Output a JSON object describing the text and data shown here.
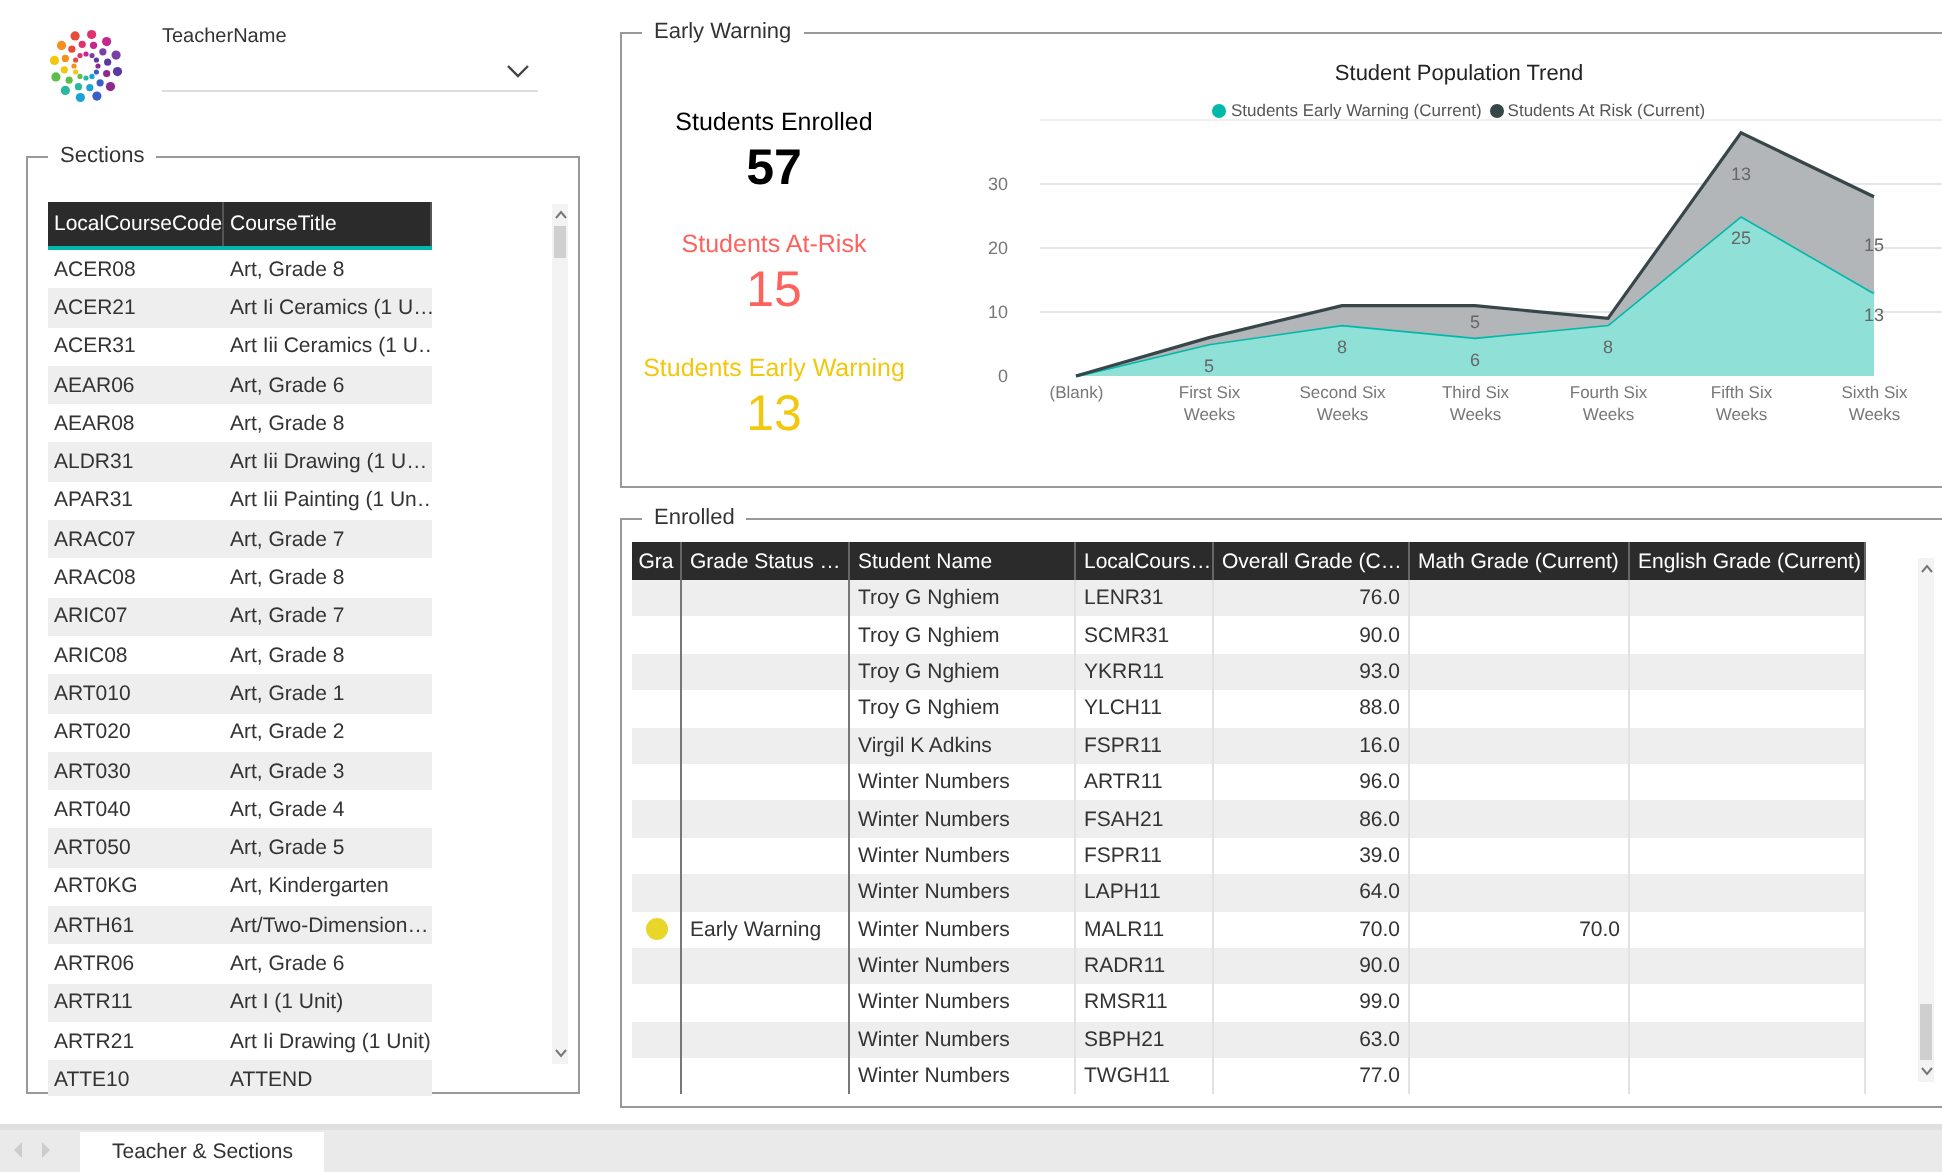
{
  "teacher_filter": {
    "label": "TeacherName"
  },
  "sections": {
    "title": "Sections",
    "columns": [
      "LocalCourseCode",
      "CourseTitle"
    ],
    "rows": [
      [
        "ACER08",
        "Art, Grade 8"
      ],
      [
        "ACER21",
        "Art Ii Ceramics (1 U…"
      ],
      [
        "ACER31",
        "Art Iii Ceramics (1 U…"
      ],
      [
        "AEAR06",
        "Art, Grade 6"
      ],
      [
        "AEAR08",
        "Art, Grade 8"
      ],
      [
        "ALDR31",
        "Art Iii Drawing (1 U…"
      ],
      [
        "APAR31",
        "Art Iii Painting (1 Un…"
      ],
      [
        "ARAC07",
        "Art, Grade 7"
      ],
      [
        "ARAC08",
        "Art, Grade 8"
      ],
      [
        "ARIC07",
        "Art, Grade 7"
      ],
      [
        "ARIC08",
        "Art, Grade 8"
      ],
      [
        "ART010",
        "Art, Grade 1"
      ],
      [
        "ART020",
        "Art, Grade 2"
      ],
      [
        "ART030",
        "Art, Grade 3"
      ],
      [
        "ART040",
        "Art, Grade 4"
      ],
      [
        "ART050",
        "Art, Grade 5"
      ],
      [
        "ART0KG",
        "Art, Kindergarten"
      ],
      [
        "ARTH61",
        "Art/Two-Dimension…"
      ],
      [
        "ARTR06",
        "Art, Grade 6"
      ],
      [
        "ARTR11",
        "Art I (1 Unit)"
      ],
      [
        "ARTR21",
        "Art Ii Drawing (1 Unit)"
      ],
      [
        "ATTE10",
        "ATTEND"
      ]
    ]
  },
  "early_warning": {
    "title": "Early Warning",
    "kpis": [
      {
        "label": "Students Enrolled",
        "value": "57",
        "color": "#000000"
      },
      {
        "label": "Students At-Risk",
        "value": "15",
        "color": "#fd625e"
      },
      {
        "label": "Students Early Warning",
        "value": "13",
        "color": "#f2c80f"
      }
    ],
    "chart_data": {
      "type": "area",
      "title": "Student Population Trend",
      "stacked": true,
      "categories": [
        "(Blank)",
        "First Six Weeks",
        "Second Six Weeks",
        "Third Six Weeks",
        "Fourth Six Weeks",
        "Fifth Six Weeks",
        "Sixth Six Weeks"
      ],
      "yticks": [
        0,
        10,
        20,
        30
      ],
      "ylim": [
        0,
        40
      ],
      "grid": true,
      "legend": "top",
      "series": [
        {
          "name": "Students Early Warning (Current)",
          "color": "#01b8aa",
          "values": [
            0,
            5,
            8,
            6,
            8,
            25,
            13
          ],
          "value_labels": [
            null,
            "5",
            "8",
            "6",
            "8",
            "25",
            "13"
          ]
        },
        {
          "name": "Students At Risk (Current)",
          "color": "#374649",
          "values": [
            0,
            1,
            3,
            5,
            1,
            13,
            15
          ],
          "value_labels": [
            null,
            null,
            null,
            "5",
            null,
            "13",
            "15"
          ]
        }
      ]
    }
  },
  "enrolled": {
    "title": "Enrolled",
    "columns": [
      "Gra",
      "Grade Status …",
      "Student Name",
      "LocalCours…",
      "Overall Grade (C…",
      "Math Grade (Current)",
      "English Grade (Current)"
    ],
    "rows": [
      {
        "student": "Troy G Nghiem",
        "course": "LENR31",
        "overall": "76.0"
      },
      {
        "student": "Troy G Nghiem",
        "course": "SCMR31",
        "overall": "90.0"
      },
      {
        "student": "Troy G Nghiem",
        "course": "YKRR11",
        "overall": "93.0"
      },
      {
        "student": "Troy G Nghiem",
        "course": "YLCH11",
        "overall": "88.0"
      },
      {
        "student": "Virgil K Adkins",
        "course": "FSPR11",
        "overall": "16.0"
      },
      {
        "student": "Winter Numbers",
        "course": "ARTR11",
        "overall": "96.0"
      },
      {
        "student": "Winter Numbers",
        "course": "FSAH21",
        "overall": "86.0"
      },
      {
        "student": "Winter Numbers",
        "course": "FSPR11",
        "overall": "39.0"
      },
      {
        "student": "Winter Numbers",
        "course": "LAPH11",
        "overall": "64.0"
      },
      {
        "color": "#e8d62b",
        "status": "Early Warning",
        "student": "Winter Numbers",
        "course": "MALR11",
        "overall": "70.0",
        "math": "70.0"
      },
      {
        "student": "Winter Numbers",
        "course": "RADR11",
        "overall": "90.0"
      },
      {
        "student": "Winter Numbers",
        "course": "RMSR11",
        "overall": "99.0"
      },
      {
        "student": "Winter Numbers",
        "course": "SBPH21",
        "overall": "63.0"
      },
      {
        "student": "Winter Numbers",
        "course": "TWGH11",
        "overall": "77.0"
      }
    ]
  },
  "page_tabs": [
    {
      "label": "Teacher & Sections",
      "selected": true
    }
  ]
}
